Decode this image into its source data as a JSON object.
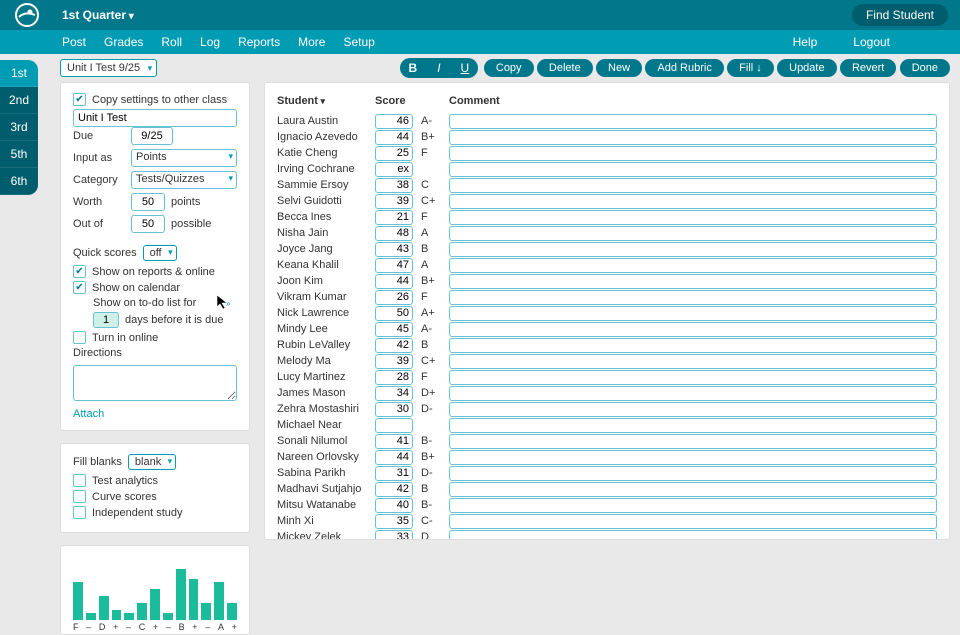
{
  "header": {
    "quarter": "1st Quarter",
    "find_student": "Find Student"
  },
  "menu": {
    "items": [
      "Post",
      "Grades",
      "Roll",
      "Log",
      "Reports",
      "More",
      "Setup"
    ],
    "right": [
      "Help",
      "Logout"
    ]
  },
  "sidetabs": [
    "1st",
    "2nd",
    "3rd",
    "5th",
    "6th"
  ],
  "toolbar": {
    "assignment": "Unit I Test 9/25",
    "fmt": {
      "b": "B",
      "i": "I",
      "u": "U"
    },
    "pills": [
      "Copy",
      "Delete",
      "New",
      "Add Rubric",
      "Fill ↓",
      "Update",
      "Revert",
      "Done"
    ]
  },
  "settings": {
    "copy_label": "Copy settings to other class",
    "title": "Unit I Test",
    "due_label": "Due",
    "due": "9/25",
    "input_as_label": "Input as",
    "input_as": "Points",
    "category_label": "Category",
    "category": "Tests/Quizzes",
    "worth_label": "Worth",
    "worth": "50",
    "worth_unit": "points",
    "outof_label": "Out of",
    "outof": "50",
    "outof_unit": "possible",
    "quick_label": "Quick scores",
    "quick_val": "off",
    "show_reports": "Show on reports & online",
    "show_calendar": "Show on calendar",
    "todo1": "Show on to-do list for",
    "todo_days": "1",
    "todo2": "days before it is due",
    "turnin": "Turn in online",
    "directions_label": "Directions",
    "attach": "Attach"
  },
  "options": {
    "fill_label": "Fill blanks",
    "fill_val": "blank",
    "items": [
      "Test analytics",
      "Curve scores",
      "Independent study"
    ]
  },
  "chart_data": {
    "type": "bar",
    "categories": [
      "F",
      "–",
      "D",
      "+",
      "–",
      "C",
      "+",
      "–",
      "B",
      "+",
      "–",
      "A",
      "+"
    ],
    "values": [
      22,
      4,
      14,
      6,
      4,
      10,
      18,
      4,
      30,
      24,
      10,
      22,
      10
    ],
    "ylim": [
      0,
      35
    ]
  },
  "grid": {
    "headers": {
      "student": "Student",
      "score": "Score",
      "comment": "Comment"
    },
    "rows": [
      {
        "name": "Laura Austin",
        "score": "46",
        "grade": "A-"
      },
      {
        "name": "Ignacio Azevedo",
        "score": "44",
        "grade": "B+"
      },
      {
        "name": "Katie Cheng",
        "score": "25",
        "grade": "F"
      },
      {
        "name": "Irving Cochrane",
        "score": "ex",
        "grade": ""
      },
      {
        "name": "Sammie Ersoy",
        "score": "38",
        "grade": "C"
      },
      {
        "name": "Selvi Guidotti",
        "score": "39",
        "grade": "C+"
      },
      {
        "name": "Becca Ines",
        "score": "21",
        "grade": "F"
      },
      {
        "name": "Nisha Jain",
        "score": "48",
        "grade": "A"
      },
      {
        "name": "Joyce Jang",
        "score": "43",
        "grade": "B"
      },
      {
        "name": "Keana Khalil",
        "score": "47",
        "grade": "A"
      },
      {
        "name": "Joon Kim",
        "score": "44",
        "grade": "B+"
      },
      {
        "name": "Vikram Kumar",
        "score": "26",
        "grade": "F"
      },
      {
        "name": "Nick Lawrence",
        "score": "50",
        "grade": "A+"
      },
      {
        "name": "Mindy Lee",
        "score": "45",
        "grade": "A-"
      },
      {
        "name": "Rubin LeValley",
        "score": "42",
        "grade": "B"
      },
      {
        "name": "Melody Ma",
        "score": "39",
        "grade": "C+"
      },
      {
        "name": "Lucy Martinez",
        "score": "28",
        "grade": "F"
      },
      {
        "name": "James Mason",
        "score": "34",
        "grade": "D+"
      },
      {
        "name": "Zehra Mostashiri",
        "score": "30",
        "grade": "D-"
      },
      {
        "name": "Michael Near",
        "score": "",
        "grade": ""
      },
      {
        "name": "Sonali Nilumol",
        "score": "41",
        "grade": "B-"
      },
      {
        "name": "Nareen Orlovsky",
        "score": "44",
        "grade": "B+"
      },
      {
        "name": "Sabina Parikh",
        "score": "31",
        "grade": "D-"
      },
      {
        "name": "Madhavi Sutjahjo",
        "score": "42",
        "grade": "B"
      },
      {
        "name": "Mitsu Watanabe",
        "score": "40",
        "grade": "B-"
      },
      {
        "name": "Minh Xi",
        "score": "35",
        "grade": "C-"
      },
      {
        "name": "Mickey Zelek",
        "score": "33",
        "grade": "D"
      }
    ]
  }
}
